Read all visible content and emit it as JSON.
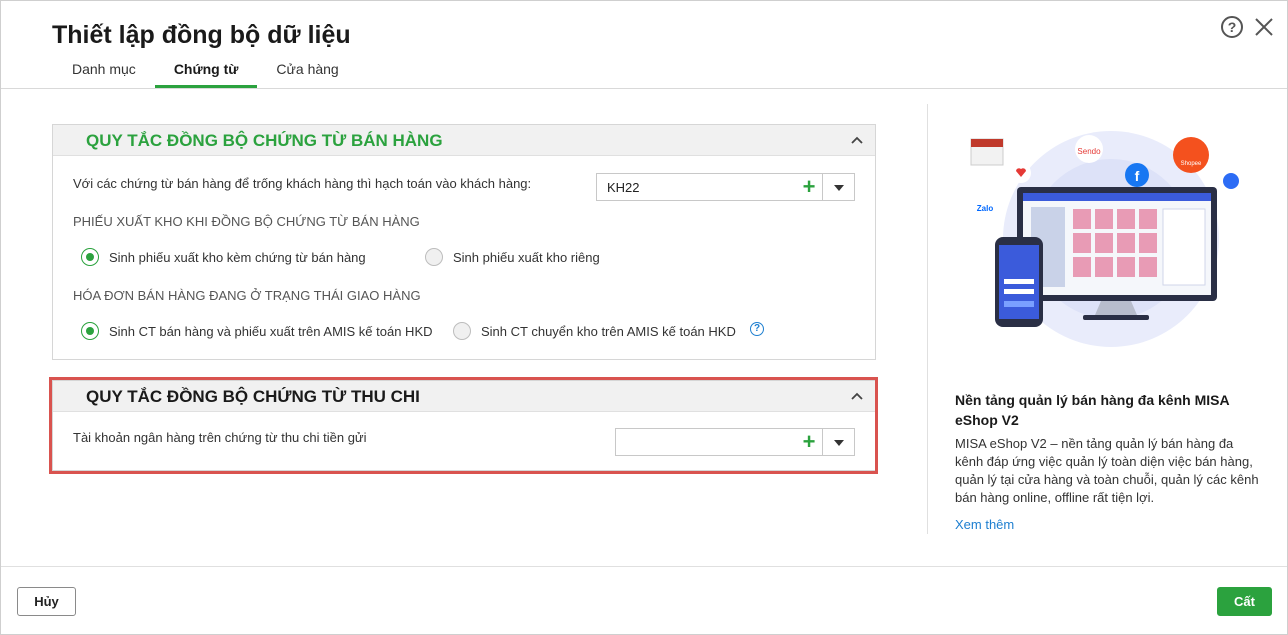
{
  "dialog": {
    "title": "Thiết lập đồng bộ dữ liệu",
    "tabs": [
      {
        "label": "Danh mục"
      },
      {
        "label": "Chứng từ",
        "active": true
      },
      {
        "label": "Cửa hàng"
      }
    ]
  },
  "sales_section": {
    "title": "QUY TẮC ĐỒNG BỘ CHỨNG TỪ BÁN HÀNG",
    "customer_label": "Với các chứng từ bán hàng để trống khách hàng thì hạch toán vào khách hàng:",
    "customer_value": "KH22",
    "stock_heading": "PHIẾU XUẤT KHO KHI ĐỒNG BỘ CHỨNG TỪ BÁN HÀNG",
    "stock_options": [
      {
        "label": "Sinh phiếu xuất kho kèm chứng từ bán hàng",
        "selected": true
      },
      {
        "label": "Sinh phiếu xuất kho riêng",
        "selected": false
      }
    ],
    "invoice_heading": "HÓA ĐƠN BÁN HÀNG ĐANG Ở TRẠNG THÁI GIAO HÀNG",
    "invoice_options": [
      {
        "label": "Sinh CT bán hàng và phiếu xuất trên AMIS kế toán HKD",
        "selected": true
      },
      {
        "label": "Sinh CT chuyển kho trên AMIS kế toán HKD",
        "selected": false
      }
    ],
    "info_icon_text": "?"
  },
  "cash_section": {
    "title": "QUY TẮC ĐỒNG BỘ CHỨNG TỪ THU CHI",
    "bank_label": "Tài khoản ngân hàng trên chứng từ thu chi tiền gửi",
    "bank_value": ""
  },
  "promo": {
    "title": "Nền tảng quản lý bán hàng đa kênh MISA eShop V2",
    "description": "MISA eShop V2 – nền tảng quản lý bán hàng đa kênh đáp ứng việc quản lý toàn diện việc bán hàng, quản lý tại cửa hàng và toàn chuỗi, quản lý các kênh bán hàng online, offline rất tiện lợi.",
    "link": "Xem thêm",
    "art_labels": {
      "sendo": "Sendo",
      "zalo": "Zalo",
      "shopee": "Shopee",
      "facebook": "f"
    }
  },
  "footer": {
    "cancel_label": "Hủy",
    "save_label": "Cất"
  },
  "colors": {
    "accent": "#2ba23e",
    "link": "#1e7fd0",
    "highlight_border": "#d9534f"
  },
  "icons": [
    "help-icon",
    "close-icon",
    "chevron-up-icon",
    "plus-icon",
    "caret-down-icon",
    "info-icon"
  ]
}
